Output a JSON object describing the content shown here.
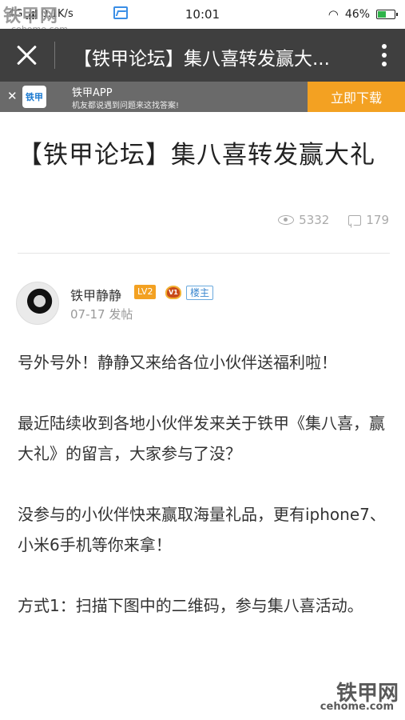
{
  "status_bar": {
    "network": "4G",
    "speed": "0.1K/s",
    "time": "10:01",
    "battery_percent": "46%",
    "battery_level": 0.46
  },
  "watermark": {
    "brand": "铁甲网",
    "domain": "cehome.com"
  },
  "header": {
    "title": "【铁甲论坛】集八喜转发赢大..."
  },
  "app_banner": {
    "logo_text": "铁甲",
    "app_name": "铁甲APP",
    "slogan": "机友都说遇到问题来这找答案!",
    "download_label": "立即下载"
  },
  "article": {
    "title": "【铁甲论坛】集八喜转发赢大礼",
    "views": "5332",
    "comments": "179"
  },
  "author": {
    "name": "铁甲静静",
    "level": "LV2",
    "vip_text": "V1",
    "owner_label": "楼主",
    "post_date": "07-17 发帖"
  },
  "body": {
    "paragraphs": [
      "号外号外！静静又来给各位小伙伴送福利啦！",
      "最近陆续收到各地小伙伴发来关于铁甲《集八喜，赢大礼》的留言，大家参与了没？",
      "没参与的小伙伴快来赢取海量礼品，更有iphone7、小米6手机等你来拿！",
      "方式1：扫描下图中的二维码，参与集八喜活动。"
    ]
  },
  "colors": {
    "header_bg": "#3f3f3f",
    "banner_bg": "#6a6a6a",
    "accent_orange": "#f3a122",
    "owner_blue": "#3b87cf"
  }
}
